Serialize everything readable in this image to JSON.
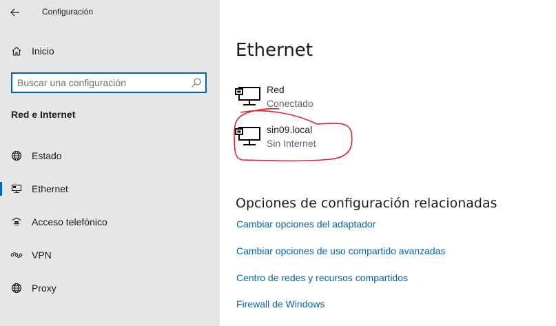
{
  "window": {
    "title": "Configuración"
  },
  "sidebar": {
    "home_label": "Inicio",
    "search": {
      "placeholder": "Buscar una configuración"
    },
    "section_title": "Red e Internet",
    "items": [
      {
        "label": "Estado",
        "icon": "globe-icon"
      },
      {
        "label": "Ethernet",
        "icon": "ethernet-icon",
        "active": true
      },
      {
        "label": "Acceso telefónico",
        "icon": "dial-up-icon"
      },
      {
        "label": "VPN",
        "icon": "vpn-icon"
      },
      {
        "label": "Proxy",
        "icon": "globe-icon"
      }
    ]
  },
  "main": {
    "title": "Ethernet",
    "networks": [
      {
        "name": "Red",
        "status": "Conectado",
        "icon": "ethernet-network-icon"
      },
      {
        "name": "sin09.local",
        "status": "Sin Internet",
        "icon": "ethernet-network-icon",
        "highlighted": true
      }
    ],
    "related": {
      "title": "Opciones de configuración relacionadas",
      "links": [
        "Cambiar opciones del adaptador",
        "Cambiar opciones de uso compartido avanzadas",
        "Centro de redes y recursos compartidos",
        "Firewall de Windows"
      ]
    }
  },
  "colors": {
    "accent": "#0063b1",
    "sidebar_bg": "#e6e6e6",
    "annotation": "#d9232e"
  }
}
